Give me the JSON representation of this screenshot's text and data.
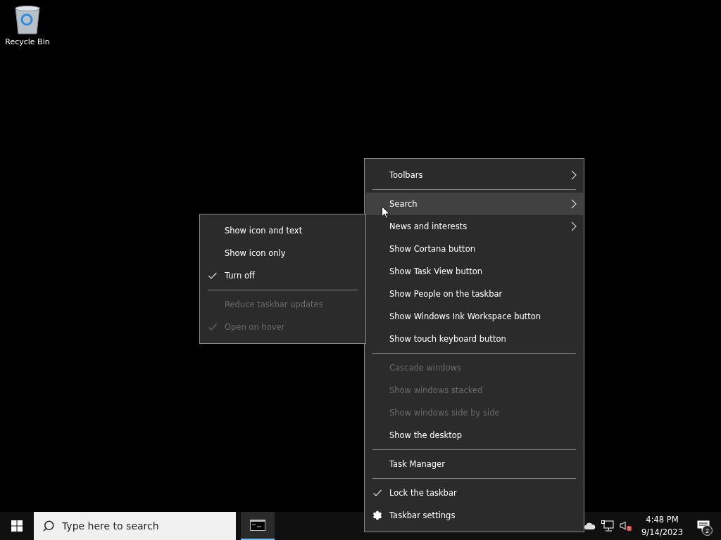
{
  "desktop_icons": [
    {
      "label": "Recycle Bin"
    }
  ],
  "context_menu": {
    "items": [
      {
        "kind": "item",
        "label": "Toolbars",
        "submenu": true,
        "checked": false,
        "disabled": false,
        "selected": false
      },
      {
        "kind": "separator"
      },
      {
        "kind": "item",
        "label": "Search",
        "submenu": true,
        "checked": false,
        "disabled": false,
        "selected": true
      },
      {
        "kind": "item",
        "label": "News and interests",
        "submenu": true,
        "checked": false,
        "disabled": false,
        "selected": false
      },
      {
        "kind": "item",
        "label": "Show Cortana button",
        "submenu": false,
        "checked": false,
        "disabled": false,
        "selected": false
      },
      {
        "kind": "item",
        "label": "Show Task View button",
        "submenu": false,
        "checked": false,
        "disabled": false,
        "selected": false
      },
      {
        "kind": "item",
        "label": "Show People on the taskbar",
        "submenu": false,
        "checked": false,
        "disabled": false,
        "selected": false
      },
      {
        "kind": "item",
        "label": "Show Windows Ink Workspace button",
        "submenu": false,
        "checked": false,
        "disabled": false,
        "selected": false
      },
      {
        "kind": "item",
        "label": "Show touch keyboard button",
        "submenu": false,
        "checked": false,
        "disabled": false,
        "selected": false
      },
      {
        "kind": "separator"
      },
      {
        "kind": "item",
        "label": "Cascade windows",
        "submenu": false,
        "checked": false,
        "disabled": true,
        "selected": false
      },
      {
        "kind": "item",
        "label": "Show windows stacked",
        "submenu": false,
        "checked": false,
        "disabled": true,
        "selected": false
      },
      {
        "kind": "item",
        "label": "Show windows side by side",
        "submenu": false,
        "checked": false,
        "disabled": true,
        "selected": false
      },
      {
        "kind": "item",
        "label": "Show the desktop",
        "submenu": false,
        "checked": false,
        "disabled": false,
        "selected": false
      },
      {
        "kind": "separator"
      },
      {
        "kind": "item",
        "label": "Task Manager",
        "submenu": false,
        "checked": false,
        "disabled": false,
        "selected": false
      },
      {
        "kind": "separator"
      },
      {
        "kind": "item",
        "label": "Lock the taskbar",
        "submenu": false,
        "checked": true,
        "disabled": false,
        "selected": false
      },
      {
        "kind": "settings",
        "label": "Taskbar settings",
        "submenu": false,
        "checked": false,
        "disabled": false,
        "selected": false
      }
    ]
  },
  "search_submenu": {
    "items": [
      {
        "kind": "item",
        "label": "Show icon and text",
        "checked": false,
        "disabled": false
      },
      {
        "kind": "item",
        "label": "Show icon only",
        "checked": false,
        "disabled": false
      },
      {
        "kind": "item",
        "label": "Turn off",
        "checked": true,
        "disabled": false
      },
      {
        "kind": "separator"
      },
      {
        "kind": "item",
        "label": "Reduce taskbar updates",
        "checked": false,
        "disabled": true
      },
      {
        "kind": "item",
        "label": "Open on hover",
        "checked": true,
        "disabled": true
      }
    ]
  },
  "taskbar": {
    "search": {
      "placeholder": "Type here to search"
    },
    "apps": [
      {
        "kind": "terminal",
        "selected": true
      }
    ],
    "clock": {
      "time": "4:48 PM",
      "date": "9/14/2023"
    },
    "notifications": {
      "count": "2"
    }
  }
}
